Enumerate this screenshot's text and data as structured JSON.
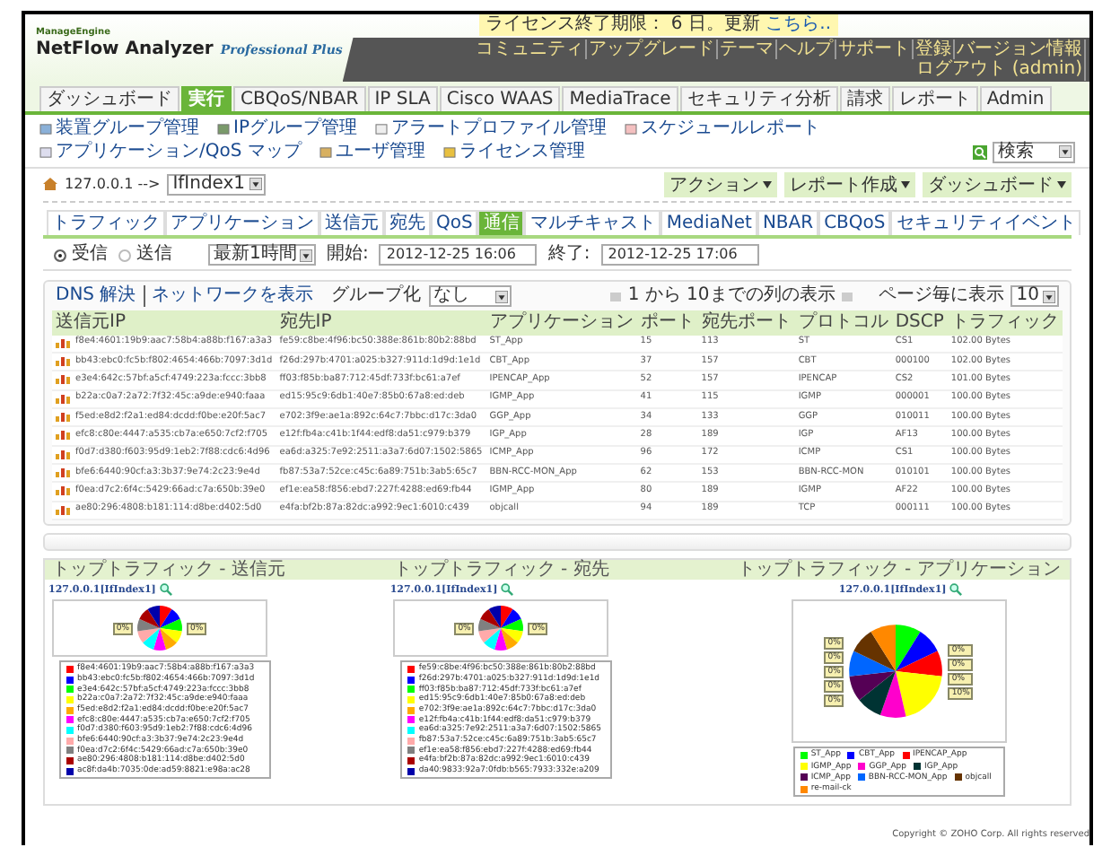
{
  "header": {
    "vendor": "ManageEngine",
    "product": "NetFlow Analyzer",
    "edition": "Professional Plus",
    "license_notice": "ライセンス終了期限： 6 日。更新",
    "license_link": "こちら..",
    "top_links": [
      "コミュニティ",
      "アップグレード",
      "テーマ",
      "ヘルプ",
      "サポート",
      "登録",
      "バージョン情報",
      "ログアウト (admin)"
    ]
  },
  "main_tabs": [
    {
      "label": "ダッシュボード",
      "selected": false
    },
    {
      "label": "実行",
      "selected": true
    },
    {
      "label": "CBQoS/NBAR",
      "selected": false
    },
    {
      "label": "IP SLA",
      "selected": false
    },
    {
      "label": "Cisco WAAS",
      "selected": false
    },
    {
      "label": "MediaTrace",
      "selected": false
    },
    {
      "label": "セキュリティ分析",
      "selected": false
    },
    {
      "label": "請求",
      "selected": false
    },
    {
      "label": "レポート",
      "selected": false
    },
    {
      "label": "Admin",
      "selected": false
    }
  ],
  "toolbar": {
    "items": [
      "装置グループ管理",
      "IPグループ管理",
      "アラートプロファイル管理",
      "スケジュールレポート",
      "アプリケーション/QoS マップ",
      "ユーザ管理",
      "ライセンス管理"
    ],
    "search_option": "検索"
  },
  "breadcrumb": {
    "device": "127.0.0.1 -->",
    "interface": "IfIndex1"
  },
  "actions": [
    "アクション",
    "レポート作成",
    "ダッシュボード"
  ],
  "sub_tabs": [
    {
      "label": "トラフィック",
      "selected": false
    },
    {
      "label": "アプリケーション",
      "selected": false
    },
    {
      "label": "送信元",
      "selected": false
    },
    {
      "label": "宛先",
      "selected": false
    },
    {
      "label": "QoS",
      "selected": false
    },
    {
      "label": "通信",
      "selected": true
    },
    {
      "label": "マルチキャスト",
      "selected": false
    },
    {
      "label": "MediaNet",
      "selected": false
    },
    {
      "label": "NBAR",
      "selected": false
    },
    {
      "label": "CBQoS",
      "selected": false
    },
    {
      "label": "セキュリティイベント",
      "selected": false
    }
  ],
  "filter": {
    "directions": [
      {
        "label": "受信",
        "selected": true
      },
      {
        "label": "送信",
        "selected": false
      }
    ],
    "period": "最新1時間",
    "start_label": "開始:",
    "start": "2012-12-25 16:06",
    "end_label": "終了:",
    "end": "2012-12-25 17:06"
  },
  "table_toolbar": {
    "links": [
      "DNS 解決",
      "ネットワークを表示"
    ],
    "group_label": "グループ化",
    "group_value": "なし",
    "range": "1 から 10までの列の表示",
    "per_page_label": "ページ毎に表示",
    "per_page": "10"
  },
  "table": {
    "columns": [
      "送信元IP",
      "宛先IP",
      "アプリケーション",
      "ポート",
      "宛先ポート",
      "プロトコル",
      "DSCP",
      "トラフィック"
    ],
    "rows": [
      [
        "f8e4:4601:19b9:aac7:58b4:a88b:f167:a3a3",
        "fe59:c8be:4f96:bc50:388e:861b:80b2:88bd",
        "ST_App",
        "15",
        "113",
        "ST",
        "CS1",
        "102.00 Bytes"
      ],
      [
        "bb43:ebc0:fc5b:f802:4654:466b:7097:3d1d",
        "f26d:297b:4701:a025:b327:911d:1d9d:1e1d",
        "CBT_App",
        "37",
        "157",
        "CBT",
        "000100",
        "102.00 Bytes"
      ],
      [
        "e3e4:642c:57bf:a5cf:4749:223a:fccc:3bb8",
        "ff03:f85b:ba87:712:45df:733f:bc61:a7ef",
        "IPENCAP_App",
        "52",
        "157",
        "IPENCAP",
        "CS2",
        "101.00 Bytes"
      ],
      [
        "b22a:c0a7:2a72:7f32:45c:a9de:e940:faaa",
        "ed15:95c9:6db1:40e7:85b0:67a8:ed:deb",
        "IGMP_App",
        "41",
        "115",
        "IGMP",
        "000001",
        "100.00 Bytes"
      ],
      [
        "f5ed:e8d2:f2a1:ed84:dcdd:f0be:e20f:5ac7",
        "e702:3f9e:ae1a:892c:64c7:7bbc:d17c:3da0",
        "GGP_App",
        "34",
        "133",
        "GGP",
        "010011",
        "100.00 Bytes"
      ],
      [
        "efc8:c80e:4447:a535:cb7a:e650:7cf2:f705",
        "e12f:fb4a:c41b:1f44:edf8:da51:c979:b379",
        "IGP_App",
        "28",
        "189",
        "IGP",
        "AF13",
        "100.00 Bytes"
      ],
      [
        "f0d7:d380:f603:95d9:1eb2:7f88:cdc6:4d96",
        "ea6d:a325:7e92:2511:a3a7:6d07:1502:5865",
        "ICMP_App",
        "96",
        "172",
        "ICMP",
        "CS1",
        "100.00 Bytes"
      ],
      [
        "bfe6:6440:90cf:a3:3b37:9e74:2c23:9e4d",
        "fb87:53a7:52ce:c45c:6a89:751b:3ab5:65c7",
        "BBN-RCC-MON_App",
        "62",
        "153",
        "BBN-RCC-MON",
        "010101",
        "100.00 Bytes"
      ],
      [
        "f0ea:d7c2:6f4c:5429:66ad:c7a:650b:39e0",
        "ef1e:ea58:f856:ebd7:227f:4288:ed69:fb44",
        "IGMP_App",
        "80",
        "189",
        "IGMP",
        "AF22",
        "100.00 Bytes"
      ],
      [
        "ae80:296:4808:b181:114:d8be:d402:5d0",
        "e4fa:bf2b:87a:82dc:a992:9ec1:6010:c439",
        "objcall",
        "94",
        "189",
        "TCP",
        "000111",
        "100.00 Bytes"
      ]
    ]
  },
  "charts": [
    {
      "title": "トップトラフィック - 送信元",
      "link": "127.0.0.1[IfIndex1]",
      "slice_labels": [
        "0%",
        "0%"
      ],
      "legend": [
        {
          "label": "f8e4:4601:19b9:aac7:58b4:a88b:f167:a3a3",
          "color": "#ff0000"
        },
        {
          "label": "bb43:ebc0:fc5b:f802:4654:466b:7097:3d1d",
          "color": "#0000ff"
        },
        {
          "label": "e3e4:642c:57bf:a5cf:4749:223a:fccc:3bb8",
          "color": "#00ff00"
        },
        {
          "label": "b22a:c0a7:2a72:7f32:45c:a9de:e940:faaa",
          "color": "#ffff00"
        },
        {
          "label": "f5ed:e8d2:f2a1:ed84:dcdd:f0be:e20f:5ac7",
          "color": "#ffaa00"
        },
        {
          "label": "efc8:c80e:4447:a535:cb7a:e650:7cf2:f705",
          "color": "#ff00ff"
        },
        {
          "label": "f0d7:d380:f603:95d9:1eb2:7f88:cdc6:4d96",
          "color": "#00ffff"
        },
        {
          "label": "bfe6:6440:90cf:a3:3b37:9e74:2c23:9e4d",
          "color": "#ffaaaa"
        },
        {
          "label": "f0ea:d7c2:6f4c:5429:66ad:c7a:650b:39e0",
          "color": "#808080"
        },
        {
          "label": "ae80:296:4808:b181:114:d8be:d402:5d0",
          "color": "#aa0000"
        },
        {
          "label": "ac8f:da4b:7035:0de:ad59:8821:e98a:ac28",
          "color": "#0000aa"
        }
      ]
    },
    {
      "title": "トップトラフィック - 宛先",
      "link": "127.0.0.1[IfIndex1]",
      "slice_labels": [
        "0%",
        "0%"
      ],
      "legend": [
        {
          "label": "fe59:c8be:4f96:bc50:388e:861b:80b2:88bd",
          "color": "#ff0000"
        },
        {
          "label": "f26d:297b:4701:a025:b327:911d:1d9d:1e1d",
          "color": "#0000ff"
        },
        {
          "label": "ff03:f85b:ba87:712:45df:733f:bc61:a7ef",
          "color": "#00ff00"
        },
        {
          "label": "ed15:95c9:6db1:40e7:85b0:67a8:ed:deb",
          "color": "#ffff00"
        },
        {
          "label": "e702:3f9e:ae1a:892c:64c7:7bbc:d17c:3da0",
          "color": "#ffaa00"
        },
        {
          "label": "e12f:fb4a:c41b:1f44:edf8:da51:c979:b379",
          "color": "#ff00ff"
        },
        {
          "label": "ea6d:a325:7e92:2511:a3a7:6d07:1502:5865",
          "color": "#00ffff"
        },
        {
          "label": "fb87:53a7:52ce:c45c:6a89:751b:3ab5:65c7",
          "color": "#ffaaaa"
        },
        {
          "label": "ef1e:ea58:f856:ebd7:227f:4288:ed69:fb44",
          "color": "#808080"
        },
        {
          "label": "e4fa:bf2b:87a:82dc:a992:9ec1:6010:c439",
          "color": "#aa0000"
        },
        {
          "label": "da40:9833:92a7:0fdb:b565:7933:332e:a209",
          "color": "#0000aa"
        }
      ]
    },
    {
      "title": "トップトラフィック - アプリケーション",
      "link": "127.0.0.1[IfIndex1]",
      "slice_labels": [
        "0%",
        "0%",
        "0%",
        "0%",
        "0%",
        "0%",
        "0%",
        "0%",
        "10%"
      ],
      "legend": [
        {
          "label": "ST_App",
          "color": "#00ff00"
        },
        {
          "label": "CBT_App",
          "color": "#0000ff"
        },
        {
          "label": "IPENCAP_App",
          "color": "#ff0000"
        },
        {
          "label": "IGMP_App",
          "color": "#ffff00"
        },
        {
          "label": "GGP_App",
          "color": "#ff00cc"
        },
        {
          "label": "IGP_App",
          "color": "#003333"
        },
        {
          "label": "ICMP_App",
          "color": "#550055"
        },
        {
          "label": "BBN-RCC-MON_App",
          "color": "#0066ff"
        },
        {
          "label": "objcall",
          "color": "#663300"
        },
        {
          "label": "re-mail-ck",
          "color": "#ff8800"
        }
      ]
    }
  ],
  "footer": "Copyright © ZOHO Corp. All rights reserved"
}
